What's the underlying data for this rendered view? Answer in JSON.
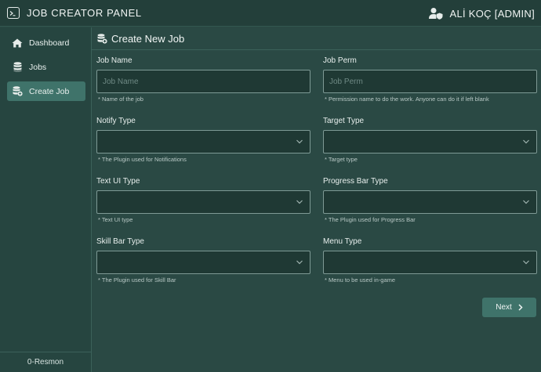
{
  "header": {
    "app_title": "JOB CREATOR PANEL",
    "user_name": "ALİ KOÇ [ADMIN]",
    "icons": {
      "app": "terminal-icon",
      "user": "user-shield-icon"
    }
  },
  "sidebar": {
    "items": [
      {
        "label": "Dashboard",
        "icon": "home-icon",
        "active": false
      },
      {
        "label": "Jobs",
        "icon": "database-icon",
        "active": false
      },
      {
        "label": "Create Job",
        "icon": "database-add-icon",
        "active": true
      }
    ],
    "footer": "0-Resmon"
  },
  "main": {
    "title": "Create New Job",
    "title_icon": "database-add-icon",
    "fields": {
      "job_name": {
        "label": "Job Name",
        "placeholder": "Job Name",
        "value": "",
        "help": "* Name of the job"
      },
      "job_perm": {
        "label": "Job Perm",
        "placeholder": "Job Perm",
        "value": "",
        "help": "* Permission name to do the work. Anyone can do it if left blank"
      },
      "notify_type": {
        "label": "Notify Type",
        "value": "",
        "help": "* The Plugin used for Notifications"
      },
      "target_type": {
        "label": "Target Type",
        "value": "",
        "help": "* Target type"
      },
      "text_ui_type": {
        "label": "Text UI Type",
        "value": "",
        "help": "* Text UI type"
      },
      "progress_bar_type": {
        "label": "Progress Bar Type",
        "value": "",
        "help": "* The Plugin used for Progress Bar"
      },
      "skill_bar_type": {
        "label": "Skill Bar Type",
        "value": "",
        "help": "* The Plugin used for Skill Bar"
      },
      "menu_type": {
        "label": "Menu Type",
        "value": "",
        "help": "* Menu to be used in-game"
      }
    },
    "next_label": "Next"
  },
  "colors": {
    "background": "#2a4944",
    "topbar": "#233f3a",
    "sidebar": "#264540",
    "accent": "#3f736a",
    "input_bg": "#1f3934",
    "input_border": "#7e9a95"
  }
}
